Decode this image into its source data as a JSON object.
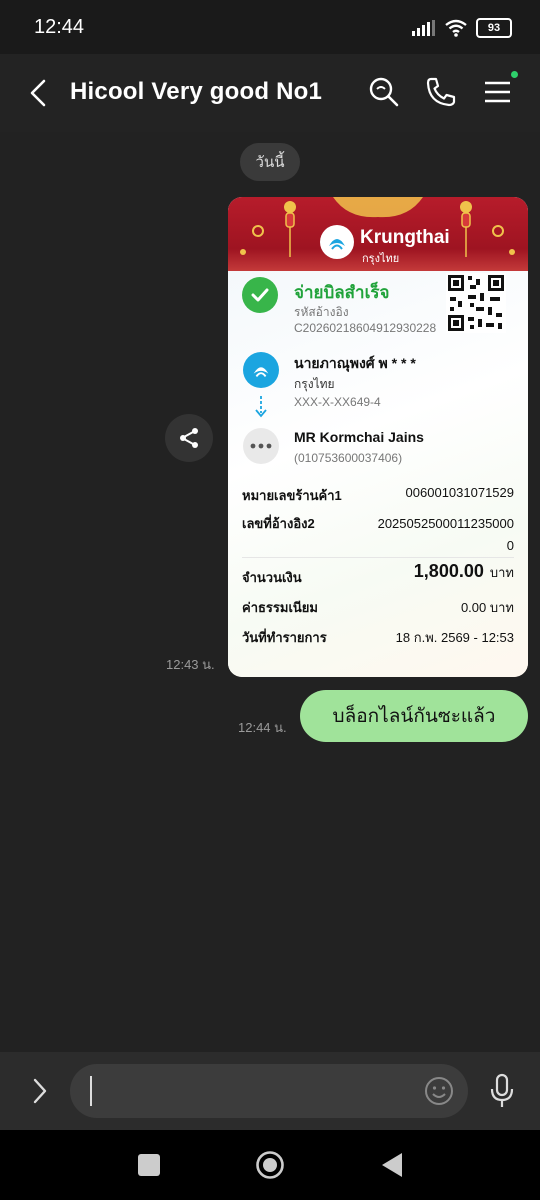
{
  "status": {
    "time": "12:44",
    "battery": "93"
  },
  "header": {
    "title": "Hicool Very good No1"
  },
  "chat": {
    "date_pill": "วันนี้",
    "receipt_time": "12:43 น.",
    "message_time": "12:44 น.",
    "message_text": "บล็อกไลน์กันซะแล้ว"
  },
  "receipt": {
    "bank_name": "Krungthai",
    "bank_name_th": "กรุงไทย",
    "status_title": "จ่ายบิลสำเร็จ",
    "ref_label": "รหัสอ้างอิง",
    "ref_code": "C20260218604912930228",
    "sender_name": "นายภาณุพงศ์ พ * * *",
    "sender_bank": "กรุงไทย",
    "sender_account": "XXX-X-XX649-4",
    "receiver_name": "MR Kormchai Jains",
    "receiver_id": "(010753600037406)",
    "rows": [
      {
        "label": "หมายเลขร้านค้า1",
        "value": "006001031071529"
      },
      {
        "label": "เลขที่อ้างอิง2",
        "value": "20250525000112350000"
      }
    ],
    "amount_label": "จำนวนเงิน",
    "amount_value": "1,800.00",
    "amount_unit": "บาท",
    "fee_label": "ค่าธรรมเนียม",
    "fee_value": "0.00 บาท",
    "date_label": "วันที่ทำรายการ",
    "date_value": "18 ก.พ. 2569 - 12:53"
  },
  "colors": {
    "accent_green": "#a0e39a",
    "bank_red": "#b71c2b",
    "success_green": "#21a33b",
    "bank_blue": "#1ba5e0"
  }
}
